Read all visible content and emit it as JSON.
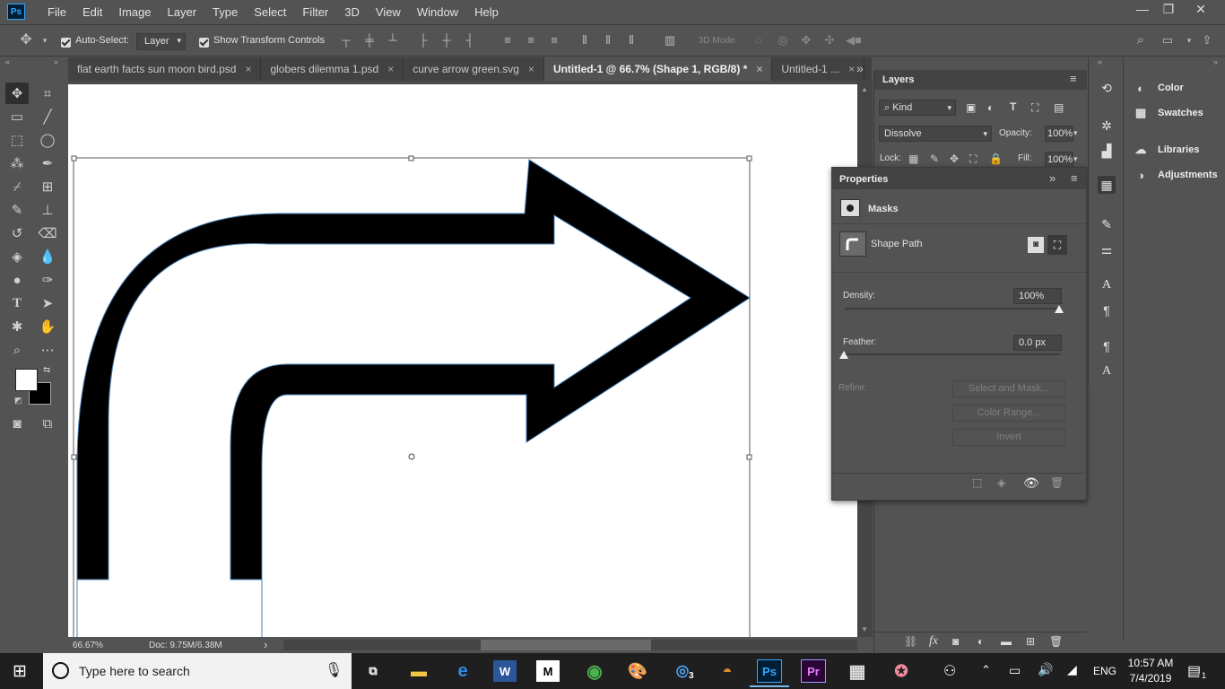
{
  "menubar": {
    "logo": "Ps",
    "items": [
      "File",
      "Edit",
      "Image",
      "Layer",
      "Type",
      "Select",
      "Filter",
      "3D",
      "View",
      "Window",
      "Help"
    ],
    "window_controls": [
      "—",
      "❐",
      "✕"
    ]
  },
  "options": {
    "auto_select_label": "Auto-Select:",
    "auto_select_value": "Layer",
    "transform_label": "Show Transform Controls",
    "mode_3d_label": "3D Mode:"
  },
  "tabs": [
    {
      "label": "flat earth facts sun moon bird.psd",
      "close": "×"
    },
    {
      "label": "globers dilemma 1.psd",
      "close": "×"
    },
    {
      "label": "curve arrow green.svg",
      "close": "×"
    },
    {
      "label": "Untitled-1 @ 66.7% (Shape 1, RGB/8) *",
      "close": "×",
      "active": true
    },
    {
      "label": "Untitled-1 ...",
      "close": "×"
    }
  ],
  "tabs_overflow": "»",
  "status": {
    "zoom": "66.67%",
    "doc": "Doc: 9.75M/6.38M",
    "arrow": "›"
  },
  "layers": {
    "title": "Layers",
    "kind_label": "Kind",
    "blend_mode": "Dissolve",
    "opacity_label": "Opacity:",
    "opacity_value": "100%",
    "lock_label": "Lock:",
    "fill_label": "Fill:",
    "fill_value": "100%",
    "footer_icons": [
      "link-icon",
      "fx-icon",
      "mask-icon",
      "adjustment-icon",
      "folder-icon",
      "new-layer-icon",
      "trash-icon"
    ]
  },
  "properties": {
    "title": "Properties",
    "section": "Masks",
    "shape_path_label": "Shape Path",
    "density_label": "Density:",
    "density_value": "100%",
    "density_level": 1.0,
    "feather_label": "Feather:",
    "feather_value": "0.0 px",
    "feather_level": 0.0,
    "refine_label": "Refine:",
    "select_mask_btn": "Select and Mask...",
    "color_range_btn": "Color Range...",
    "invert_btn": "Invert"
  },
  "dock": {
    "items": [
      {
        "label": "Color",
        "icon": "color-icon"
      },
      {
        "label": "Swatches",
        "icon": "swatches-icon"
      },
      {
        "label": "Libraries",
        "icon": "libraries-icon"
      },
      {
        "label": "Adjustments",
        "icon": "adjustments-icon"
      }
    ]
  },
  "taskbar": {
    "search_placeholder": "Type here to search",
    "time": "10:57 AM",
    "date": "7/4/2019",
    "language": "ENG",
    "notification_count": "1",
    "instagram_badge": "3",
    "apps": [
      "task-view",
      "file-explorer",
      "edge",
      "word",
      "capcut",
      "chrome",
      "paint",
      "instagram",
      "game",
      "photoshop",
      "premiere",
      "calculator",
      "app"
    ]
  },
  "colors": {
    "ui_gray": "#535353",
    "canvas_white": "#ffffff",
    "arrow_fill": "#000000",
    "path_outline": "#4a7fb5",
    "ps_blue": "#31a8ff",
    "taskbar": "#1f1f1f"
  }
}
